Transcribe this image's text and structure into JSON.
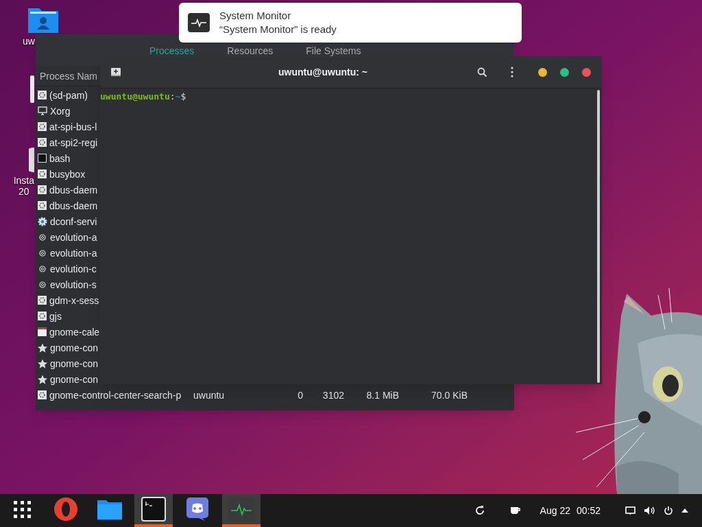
{
  "desktop_icons": [
    {
      "kind": "folder",
      "label": "uw"
    },
    {
      "kind": "trash"
    },
    {
      "kind": "disc",
      "label": "Insta\n20"
    }
  ],
  "system_monitor": {
    "tabs": [
      {
        "label": "Processes",
        "selected": true
      },
      {
        "label": "Resources",
        "selected": false
      },
      {
        "label": "File Systems",
        "selected": false
      }
    ],
    "column_header": "Process Nam",
    "rows": [
      {
        "kind": "gear",
        "cells": [
          "(sd-pam)"
        ]
      },
      {
        "kind": "monitor",
        "cells": [
          "Xorg"
        ]
      },
      {
        "kind": "gear",
        "cells": [
          "at-spi-bus-l"
        ]
      },
      {
        "kind": "gear",
        "cells": [
          "at-spi2-regi"
        ]
      },
      {
        "kind": "terminal",
        "cells": [
          "bash"
        ]
      },
      {
        "kind": "gear",
        "cells": [
          "busybox"
        ]
      },
      {
        "kind": "gear",
        "cells": [
          "dbus-daem"
        ]
      },
      {
        "kind": "gear",
        "cells": [
          "dbus-daem"
        ]
      },
      {
        "kind": "cog",
        "cells": [
          "dconf-servi"
        ]
      },
      {
        "kind": "at",
        "cells": [
          "evolution-a"
        ]
      },
      {
        "kind": "at",
        "cells": [
          "evolution-a"
        ]
      },
      {
        "kind": "at",
        "cells": [
          "evolution-c"
        ]
      },
      {
        "kind": "at",
        "cells": [
          "evolution-s"
        ]
      },
      {
        "kind": "gear",
        "cells": [
          "gdm-x-sess"
        ]
      },
      {
        "kind": "gear",
        "cells": [
          "gjs"
        ]
      },
      {
        "kind": "calendar",
        "cells": [
          "gnome-cale"
        ]
      },
      {
        "kind": "star",
        "cells": [
          "gnome-con"
        ]
      },
      {
        "kind": "star",
        "cells": [
          "gnome-con"
        ]
      },
      {
        "kind": "star",
        "cells": [
          "gnome-con"
        ]
      },
      {
        "kind": "gear",
        "cells": [
          "gnome-control-center-search-p",
          "uwuntu",
          "0",
          "3102",
          "8.1 MiB",
          "70.0 KiB"
        ]
      }
    ]
  },
  "notification": {
    "title": "System Monitor",
    "body": "“System Monitor” is ready"
  },
  "terminal": {
    "title": "uwuntu@uwuntu: ~",
    "prompt_user": "uwuntu@uwuntu",
    "prompt_sep": ":",
    "prompt_path": "~",
    "prompt_sign": "$"
  },
  "taskbar": {
    "apps": [
      {
        "kind": "grid",
        "active": false
      },
      {
        "kind": "browser",
        "active": false
      },
      {
        "kind": "files",
        "active": false
      },
      {
        "kind": "terminal",
        "active": true
      },
      {
        "kind": "chat",
        "active": false
      },
      {
        "kind": "monitor",
        "active": true
      }
    ],
    "date": "Aug 22",
    "time": "00:52"
  }
}
